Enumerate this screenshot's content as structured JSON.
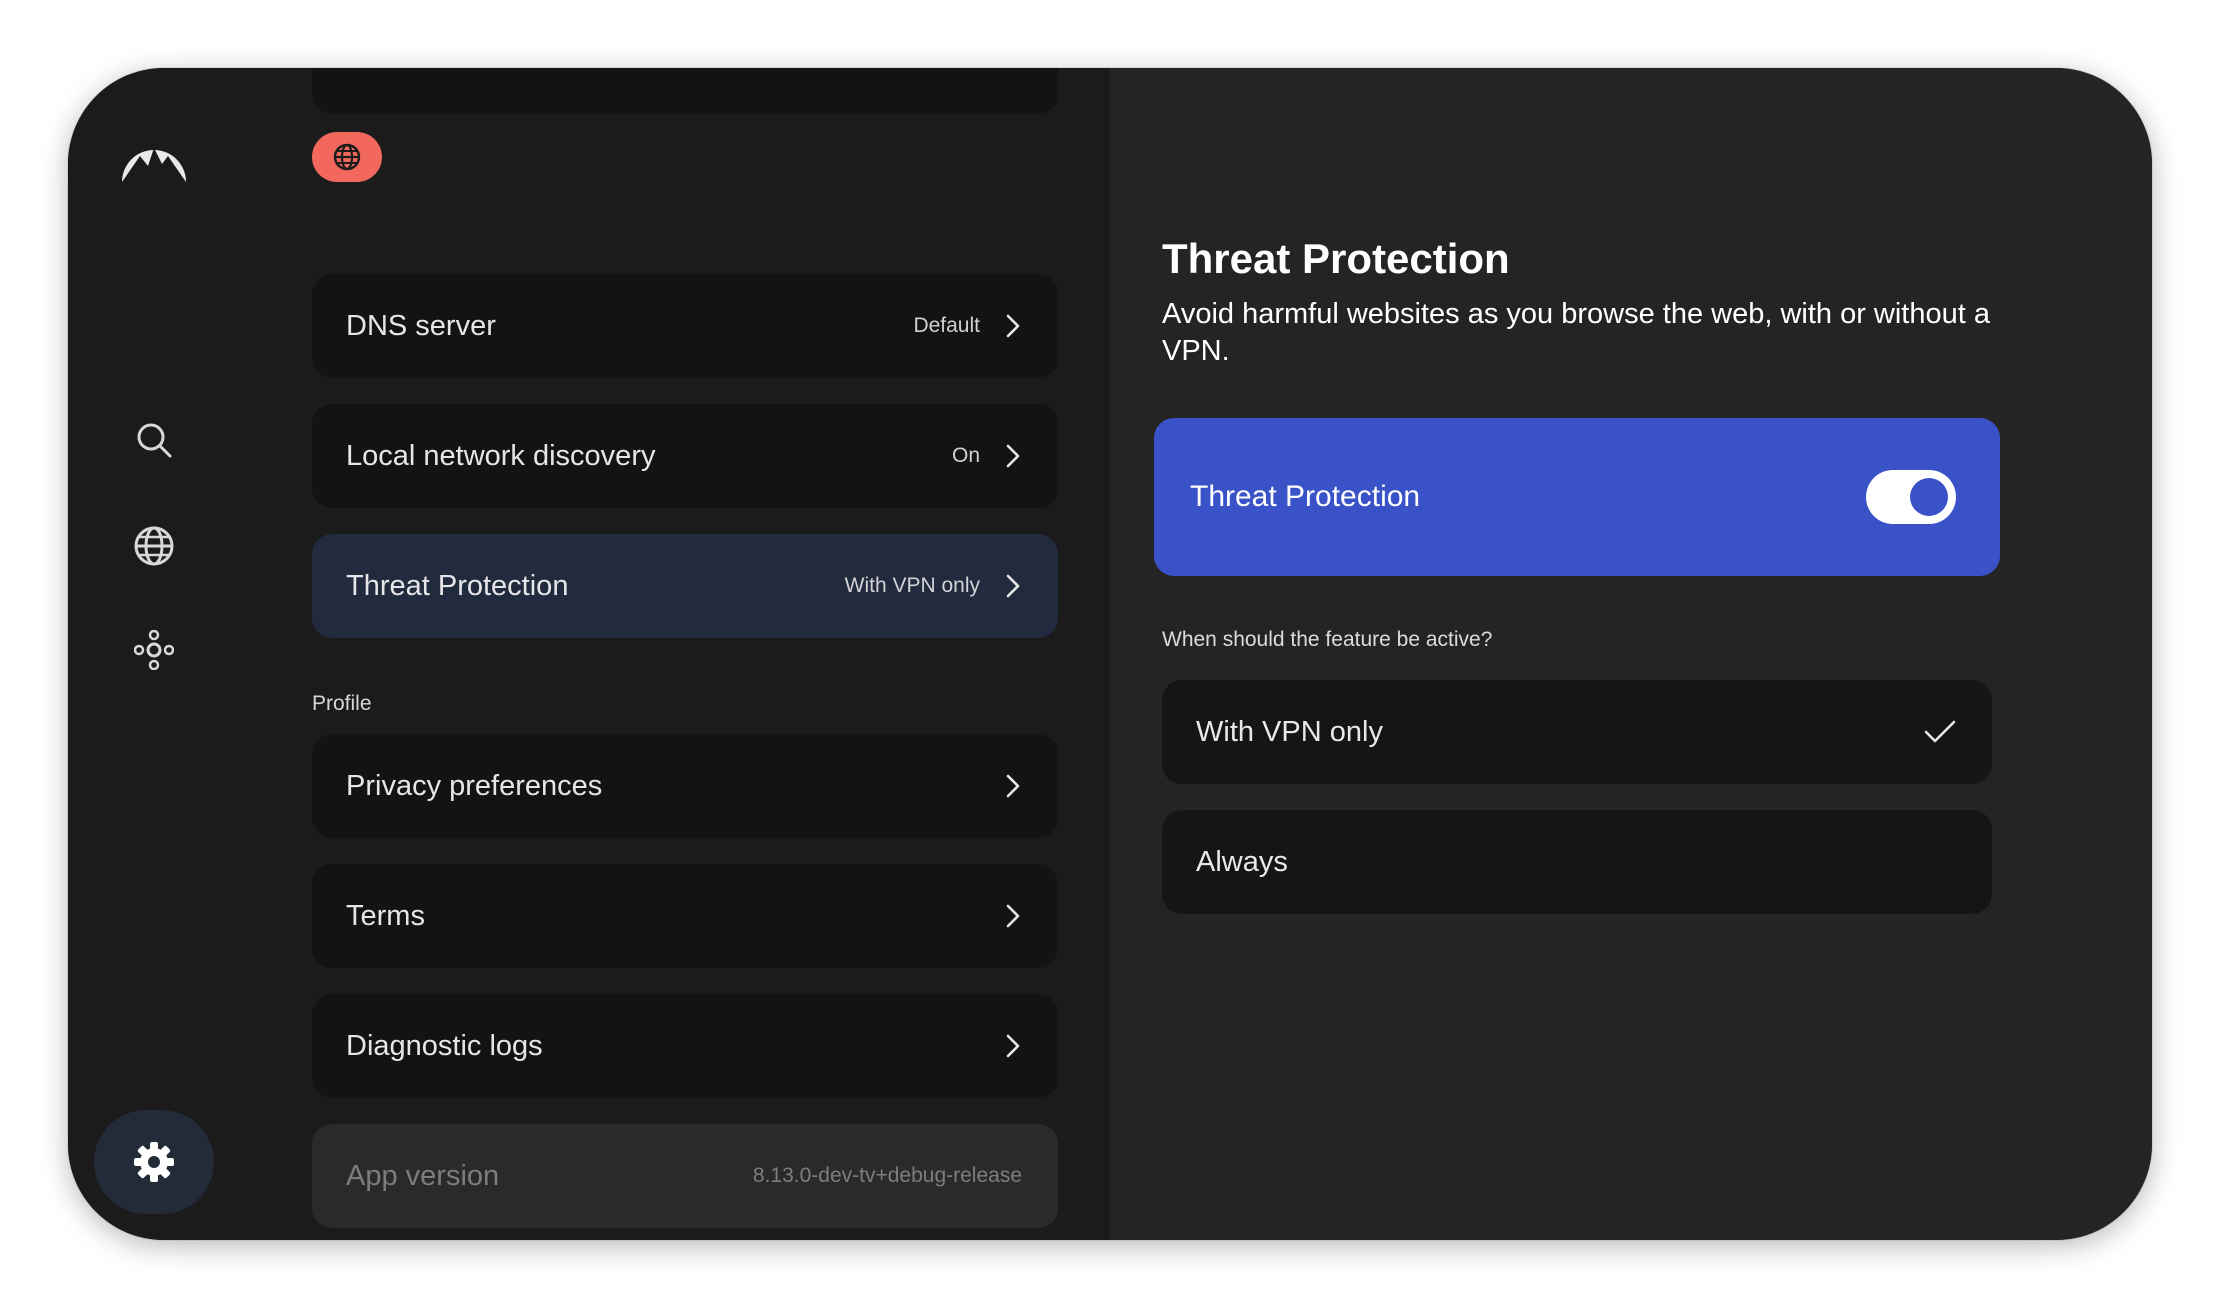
{
  "rail": {
    "logo_icon": "mountain-logo",
    "items": [
      {
        "name": "search",
        "icon": "search-icon"
      },
      {
        "name": "countries",
        "icon": "globe-icon"
      },
      {
        "name": "meshnet",
        "icon": "network-nodes-icon"
      },
      {
        "name": "settings",
        "icon": "gear-icon",
        "selected": true
      }
    ]
  },
  "header": {
    "status_icon": "globe-icon",
    "status_color": "#f2685c"
  },
  "settings_list": {
    "rows": [
      {
        "label": "DNS server",
        "value": "Default"
      },
      {
        "label": "Local network discovery",
        "value": "On"
      },
      {
        "label": "Threat Protection",
        "value": "With VPN only",
        "selected": true
      }
    ],
    "profile_section_label": "Profile",
    "profile_rows": [
      {
        "label": "Privacy preferences"
      },
      {
        "label": "Terms"
      },
      {
        "label": "Diagnostic logs"
      }
    ],
    "app_version": {
      "label": "App version",
      "value": "8.13.0-dev-tv+debug-release"
    }
  },
  "detail": {
    "title": "Threat Protection",
    "description": "Avoid harmful websites as you browse the web, with or without a VPN.",
    "toggle": {
      "label": "Threat Protection",
      "enabled": true
    },
    "question": "When should the feature be active?",
    "options": [
      {
        "label": "With VPN only",
        "selected": true
      },
      {
        "label": "Always",
        "selected": false
      }
    ],
    "accent_color": "#3a52c8"
  }
}
